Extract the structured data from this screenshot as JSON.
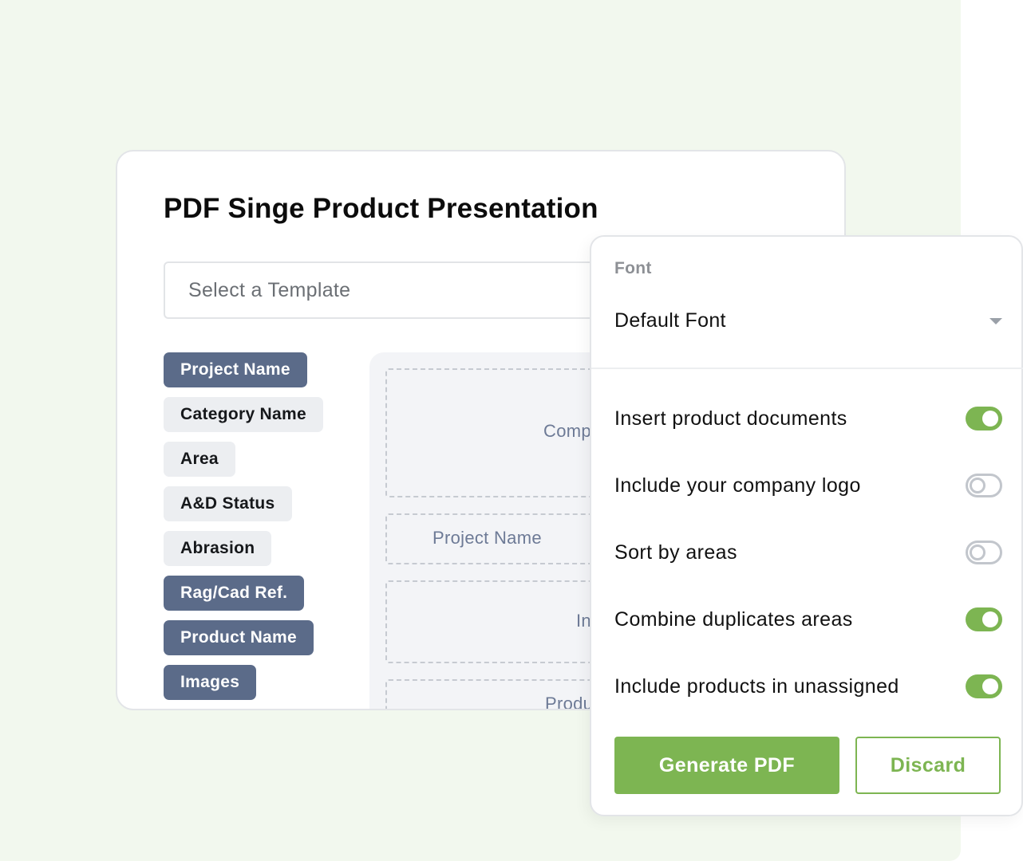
{
  "dialog": {
    "title": "PDF Singe Product Presentation",
    "template_placeholder": "Select a Template"
  },
  "fields": [
    {
      "label": "Project Name",
      "selected": true
    },
    {
      "label": "Category Name",
      "selected": false
    },
    {
      "label": "Area",
      "selected": false
    },
    {
      "label": "A&D Status",
      "selected": false
    },
    {
      "label": "Abrasion",
      "selected": false
    },
    {
      "label": "Rag/Cad Ref.",
      "selected": true
    },
    {
      "label": "Product Name",
      "selected": true
    },
    {
      "label": "Images",
      "selected": true
    }
  ],
  "preview": {
    "slots": [
      "Comp",
      "Project Name",
      "In",
      "Produ"
    ]
  },
  "settings": {
    "font_label": "Font",
    "font_value": "Default Font",
    "options": [
      {
        "label": "Insert product documents",
        "enabled": true
      },
      {
        "label": "Include your company logo",
        "enabled": false
      },
      {
        "label": "Sort by areas",
        "enabled": false
      },
      {
        "label": "Combine duplicates areas",
        "enabled": true
      },
      {
        "label": "Include products in unassigned",
        "enabled": true
      }
    ],
    "generate_label": "Generate PDF",
    "discard_label": "Discard"
  },
  "colors": {
    "accent_green": "#7db552",
    "chip_selected": "#5b6b89",
    "chip_unselected": "#eceef1",
    "background": "#f2f8ee"
  }
}
